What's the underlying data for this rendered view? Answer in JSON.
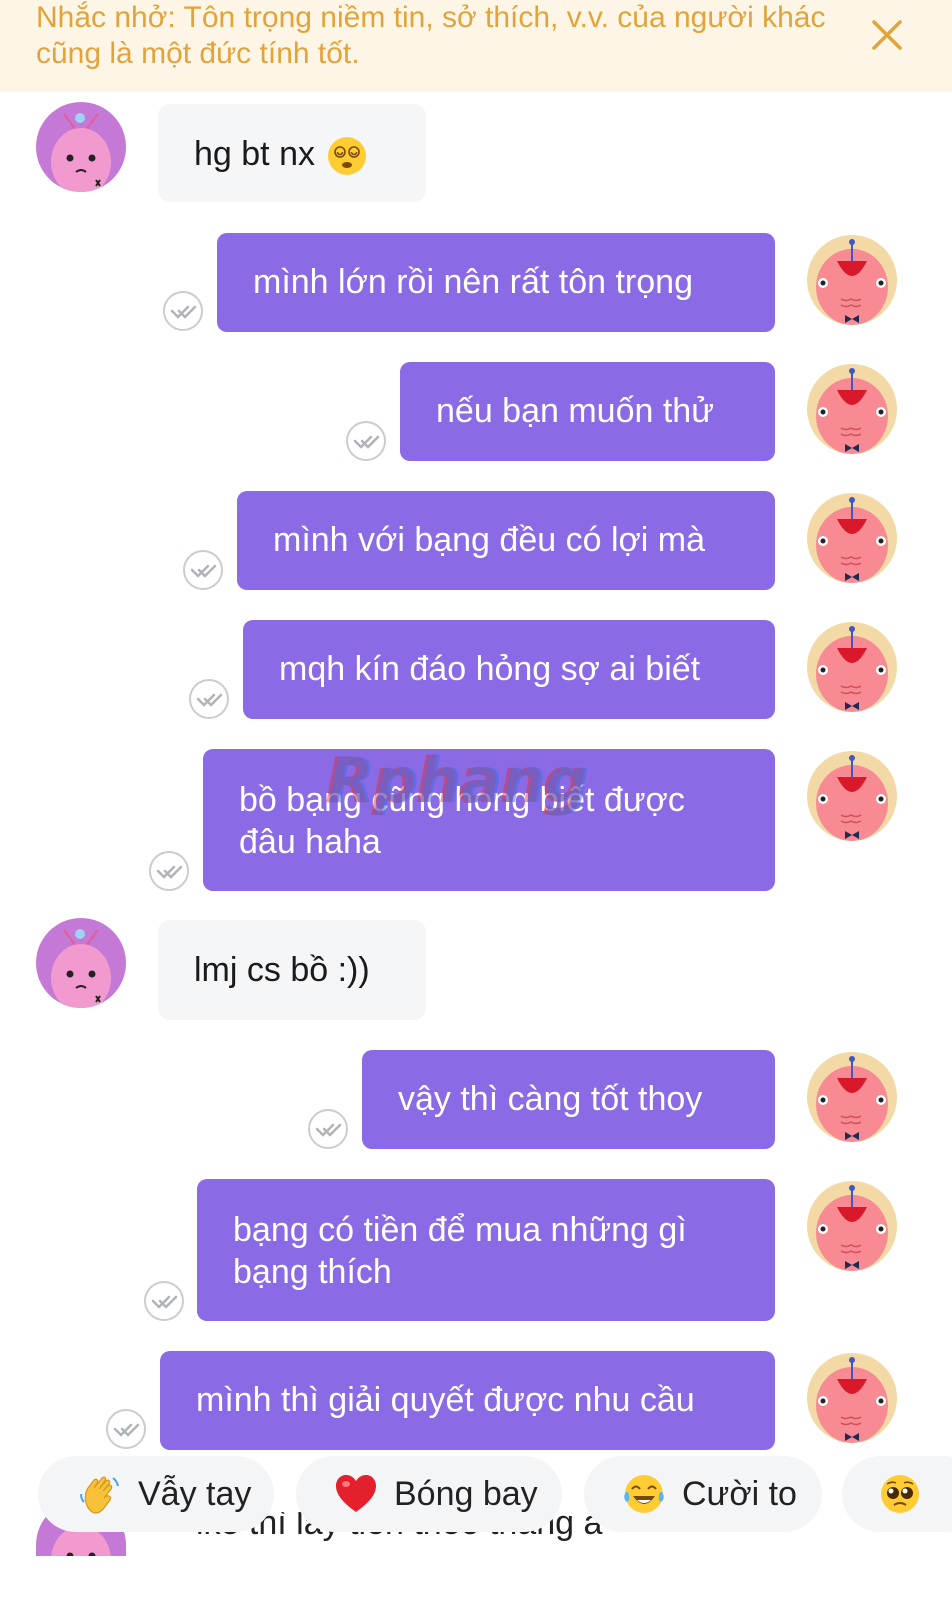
{
  "reminder": {
    "text": "Nhắc nhở: Tôn trọng niềm tin, sở thích, v.v. của người khác cũng là một đức tính tốt."
  },
  "messages": [
    {
      "side": "in",
      "text": "hg bt nx"
    },
    {
      "side": "out",
      "text": "mình lớn rồi nên rất tôn trọng"
    },
    {
      "side": "out",
      "text": "nếu bạn muốn thử"
    },
    {
      "side": "out",
      "text": "mình với bạng đều có lợi mà"
    },
    {
      "side": "out",
      "text": "mqh kín đáo hỏng sợ ai biết"
    },
    {
      "side": "out",
      "lines": [
        "bồ bạng cũng hong biết được",
        "đâu haha"
      ]
    },
    {
      "side": "in",
      "text": "lmj cs bồ :))"
    },
    {
      "side": "out",
      "text": "vậy thì càng tốt thoy"
    },
    {
      "side": "out",
      "lines": [
        "bạng có tiền để mua những gì",
        "bạng thích"
      ]
    },
    {
      "side": "out",
      "text": "mình thì giải quyết được nhu cầu"
    },
    {
      "side": "in",
      "text": "ike thì lay tien theo tháng á"
    }
  ],
  "watermark": "Rphang",
  "quick_replies": [
    {
      "label": "Vẫy tay",
      "icon": "waving-hand-icon"
    },
    {
      "label": "Bóng bay",
      "icon": "red-heart-icon"
    },
    {
      "label": "Cười to",
      "icon": "tears-of-joy-icon"
    },
    {
      "label": "",
      "icon": "pleading-face-icon"
    }
  ],
  "colors": {
    "outgoing_bubble": "#8b6be5",
    "incoming_bubble": "#f5f6f8",
    "reminder_bg": "#fdf6e6",
    "reminder_text": "#e3a33b"
  }
}
